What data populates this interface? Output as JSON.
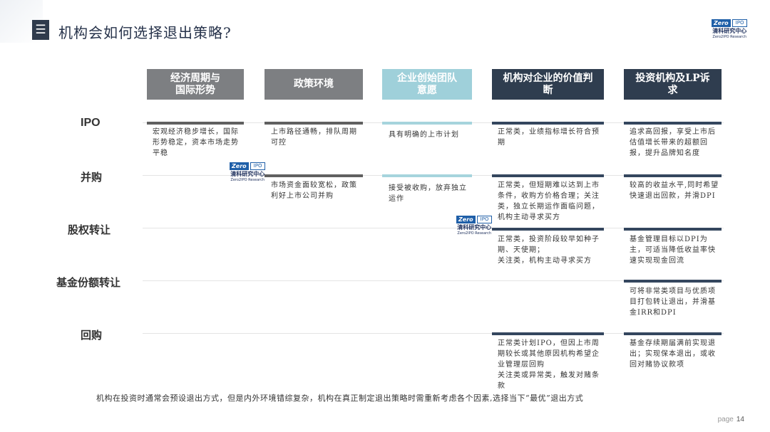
{
  "title": "机构会如何选择退出策略?",
  "title_icon": "menu-icon",
  "logo": {
    "zero": "Zero",
    "ipo": "IPO",
    "cn": "清科研究中心",
    "en": "Zero2IPO Research"
  },
  "columns": [
    {
      "label": "经济周期与\n国际形势"
    },
    {
      "label": "政策环境"
    },
    {
      "label": "企业创始团队\n意愿"
    },
    {
      "label": "机构对企业的价值判\n断"
    },
    {
      "label": "投资机构及LP诉\n求"
    }
  ],
  "rows": [
    {
      "label": "IPO"
    },
    {
      "label": "并购"
    },
    {
      "label": "股权转让"
    },
    {
      "label": "基金份额转让"
    },
    {
      "label": "回购"
    }
  ],
  "cells": {
    "ipo_c1": "宏观经济稳步增长，国际形势稳定，资本市场走势平稳",
    "ipo_c2": "上市路径通畅，排队周期可控",
    "ipo_c3": "具有明确的上市计划",
    "ipo_c4": "正常类，业绩指标增长符合预期",
    "ipo_c5": "追求高回报，享受上市后估值增长带来的超额回报，提升品牌知名度",
    "ma_c2": "市场资金面较宽松，政策利好上市公司并购",
    "ma_c3": "接受被收购，放弃独立运作",
    "ma_c4": "正常类，但短期难以达到上市条件，收购方价格合理；关注类，独立长期运作面临问题，机构主动寻求买方",
    "ma_c5": "较高的收益水平,同时希望快速退出回款，并滑DPI",
    "eq_c4": "正常类，投资阶段较早如种子期、天使期；\n关注类，机构主动寻求买方",
    "eq_c5": "基金管理目标以DPI为主，可适当降低收益率快速实现现金回流",
    "fund_c5": "可将非常类项目与优质项目打包转让退出，并滑基金IRR和DPI",
    "buy_c4": "正常类计划IPO，但因上市周期较长或其他原因机构希望企业管理层回购\n关注类或异常类，触发对赌条款",
    "buy_c5": "基金存续期届满前实现退出；实现保本退出，或收回对赌协议款项"
  },
  "footer_note": "机构在投资时通常会预设退出方式，但是内外环境错综复杂，机构在真正制定退出策略时需重新考虑各个因素,选择当下“最优”退出方式",
  "page": {
    "label": "page",
    "number": "14"
  }
}
